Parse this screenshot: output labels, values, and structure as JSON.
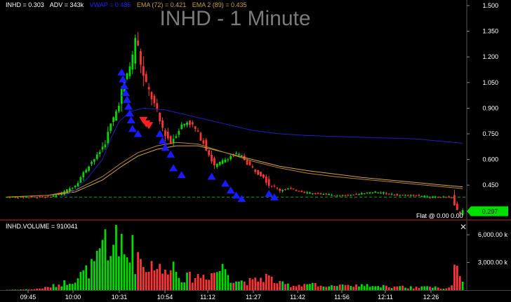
{
  "chart_data": [
    {
      "type": "candlestick",
      "title": "INHD - 1 Minute",
      "header": {
        "symbol_price": "INHD = 0.303",
        "adv": "ADV = 343k",
        "vwap": "VWAP = 0.485",
        "ema72": "EMA (72) = 0.421",
        "ema89": "EMA 2 (89) = 0.435"
      },
      "y_ticks": [
        "1.500",
        "1.350",
        "1.200",
        "1.050",
        "0.900",
        "0.750",
        "0.600",
        "0.450"
      ],
      "ylim": [
        0.25,
        1.5
      ],
      "last_price_label": "0.297",
      "last_price": 0.297,
      "reference_line": 0.38,
      "flat_label": "Flat @ 0.00  0.00",
      "x_ticks": [
        "09:45",
        "10:00",
        "10:31",
        "10:54",
        "11:12",
        "11:27",
        "11:42",
        "11:56",
        "12:11",
        "12:26"
      ],
      "price_path": [
        [
          0,
          0.38
        ],
        [
          10,
          0.38
        ],
        [
          15,
          0.38
        ],
        [
          20,
          0.4
        ],
        [
          25,
          0.45
        ],
        [
          28,
          0.52
        ],
        [
          30,
          0.57
        ],
        [
          33,
          0.62
        ],
        [
          36,
          0.7
        ],
        [
          38,
          0.8
        ],
        [
          40,
          0.88
        ],
        [
          42,
          1.0
        ],
        [
          44,
          1.1
        ],
        [
          46,
          1.2
        ],
        [
          47,
          1.32
        ],
        [
          48,
          1.25
        ],
        [
          50,
          1.08
        ],
        [
          52,
          1.0
        ],
        [
          54,
          0.92
        ],
        [
          56,
          0.82
        ],
        [
          58,
          0.75
        ],
        [
          60,
          0.7
        ],
        [
          62,
          0.75
        ],
        [
          64,
          0.8
        ],
        [
          66,
          0.82
        ],
        [
          68,
          0.8
        ],
        [
          70,
          0.75
        ],
        [
          72,
          0.7
        ],
        [
          74,
          0.63
        ],
        [
          76,
          0.56
        ],
        [
          78,
          0.58
        ],
        [
          80,
          0.6
        ],
        [
          82,
          0.62
        ],
        [
          84,
          0.63
        ],
        [
          86,
          0.62
        ],
        [
          88,
          0.58
        ],
        [
          90,
          0.55
        ],
        [
          92,
          0.52
        ],
        [
          94,
          0.5
        ],
        [
          96,
          0.45
        ],
        [
          98,
          0.44
        ],
        [
          100,
          0.42
        ],
        [
          103,
          0.43
        ],
        [
          106,
          0.42
        ],
        [
          109,
          0.41
        ],
        [
          112,
          0.4
        ],
        [
          116,
          0.4
        ],
        [
          120,
          0.39
        ],
        [
          125,
          0.39
        ],
        [
          130,
          0.4
        ],
        [
          135,
          0.41
        ],
        [
          140,
          0.4
        ],
        [
          145,
          0.39
        ],
        [
          150,
          0.39
        ],
        [
          155,
          0.38
        ],
        [
          160,
          0.38
        ],
        [
          163,
          0.38
        ],
        [
          164,
          0.33
        ],
        [
          165,
          0.29
        ],
        [
          166,
          0.28
        ],
        [
          167,
          0.297
        ]
      ],
      "vwap_path": [
        [
          20,
          0.38
        ],
        [
          25,
          0.42
        ],
        [
          30,
          0.5
        ],
        [
          35,
          0.6
        ],
        [
          38,
          0.72
        ],
        [
          41,
          0.82
        ],
        [
          45,
          0.88
        ],
        [
          50,
          0.9
        ],
        [
          58,
          0.89
        ],
        [
          66,
          0.86
        ],
        [
          74,
          0.83
        ],
        [
          82,
          0.8
        ],
        [
          90,
          0.77
        ],
        [
          100,
          0.75
        ],
        [
          110,
          0.74
        ],
        [
          120,
          0.735
        ],
        [
          130,
          0.73
        ],
        [
          140,
          0.725
        ],
        [
          150,
          0.72
        ],
        [
          160,
          0.705
        ],
        [
          167,
          0.695
        ]
      ],
      "ema72_path": [
        [
          0,
          0.38
        ],
        [
          15,
          0.39
        ],
        [
          25,
          0.42
        ],
        [
          35,
          0.5
        ],
        [
          42,
          0.58
        ],
        [
          48,
          0.64
        ],
        [
          55,
          0.68
        ],
        [
          62,
          0.7
        ],
        [
          70,
          0.69
        ],
        [
          80,
          0.64
        ],
        [
          90,
          0.59
        ],
        [
          100,
          0.55
        ],
        [
          110,
          0.52
        ],
        [
          120,
          0.5
        ],
        [
          130,
          0.485
        ],
        [
          140,
          0.47
        ],
        [
          150,
          0.455
        ],
        [
          160,
          0.44
        ],
        [
          167,
          0.43
        ]
      ],
      "ema89_path": [
        [
          0,
          0.38
        ],
        [
          15,
          0.39
        ],
        [
          25,
          0.41
        ],
        [
          35,
          0.48
        ],
        [
          42,
          0.56
        ],
        [
          48,
          0.62
        ],
        [
          55,
          0.66
        ],
        [
          62,
          0.68
        ],
        [
          70,
          0.68
        ],
        [
          80,
          0.64
        ],
        [
          90,
          0.6
        ],
        [
          100,
          0.56
        ],
        [
          110,
          0.535
        ],
        [
          120,
          0.515
        ],
        [
          130,
          0.495
        ],
        [
          140,
          0.48
        ],
        [
          150,
          0.465
        ],
        [
          160,
          0.45
        ],
        [
          167,
          0.44
        ]
      ],
      "buy_arrows": [
        [
          42,
          1.12
        ],
        [
          42.5,
          1.08
        ],
        [
          43,
          1.04
        ],
        [
          43.5,
          1.0
        ],
        [
          44,
          0.96
        ],
        [
          44.5,
          0.92
        ],
        [
          45,
          0.88
        ],
        [
          45.5,
          0.84
        ],
        [
          46,
          0.79
        ],
        [
          48,
          0.76
        ],
        [
          56,
          0.76
        ],
        [
          57,
          0.72
        ],
        [
          58,
          0.68
        ],
        [
          60,
          0.64
        ],
        [
          61,
          0.56
        ],
        [
          64,
          0.52
        ],
        [
          75,
          0.51
        ],
        [
          80,
          0.47
        ],
        [
          82,
          0.43
        ],
        [
          84,
          0.4
        ],
        [
          86,
          0.38
        ],
        [
          96,
          0.41
        ],
        [
          98,
          0.39
        ]
      ],
      "sell_arrows": [
        [
          50,
          0.82
        ],
        [
          51,
          0.8
        ],
        [
          52,
          0.79
        ]
      ]
    },
    {
      "type": "bar",
      "title": "INHD.VOLUME = 910041",
      "y_ticks": [
        "6,000.00 k",
        "3,000.00 k"
      ],
      "ylim": [
        0,
        7300
      ],
      "volume_path": [
        [
          0,
          30
        ],
        [
          10,
          100
        ],
        [
          15,
          300
        ],
        [
          20,
          700
        ],
        [
          25,
          1200
        ],
        [
          28,
          1800
        ],
        [
          30,
          2200
        ],
        [
          33,
          3000
        ],
        [
          35,
          4200
        ],
        [
          36,
          5800
        ],
        [
          37,
          3400
        ],
        [
          38,
          3800
        ],
        [
          39,
          7000
        ],
        [
          40,
          5000
        ],
        [
          41,
          3200
        ],
        [
          42,
          5600
        ],
        [
          43,
          4200
        ],
        [
          44,
          3600
        ],
        [
          45,
          5200
        ],
        [
          46,
          4400
        ],
        [
          47,
          3000
        ],
        [
          48,
          4000
        ],
        [
          50,
          2800
        ],
        [
          52,
          2500
        ],
        [
          54,
          3200
        ],
        [
          56,
          2200
        ],
        [
          58,
          1800
        ],
        [
          60,
          3600
        ],
        [
          62,
          2000
        ],
        [
          65,
          1300
        ],
        [
          70,
          1500
        ],
        [
          75,
          1800
        ],
        [
          80,
          2500
        ],
        [
          82,
          1400
        ],
        [
          85,
          1000
        ],
        [
          90,
          900
        ],
        [
          95,
          1500
        ],
        [
          100,
          700
        ],
        [
          105,
          500
        ],
        [
          110,
          700
        ],
        [
          115,
          600
        ],
        [
          120,
          500
        ],
        [
          125,
          400
        ],
        [
          130,
          500
        ],
        [
          135,
          400
        ],
        [
          140,
          400
        ],
        [
          145,
          350
        ],
        [
          150,
          300
        ],
        [
          155,
          300
        ],
        [
          160,
          250
        ],
        [
          163,
          400
        ],
        [
          164,
          2800
        ],
        [
          165,
          2000
        ],
        [
          166,
          1500
        ],
        [
          167,
          1200
        ]
      ]
    }
  ],
  "colors": {
    "up": "#00dc00",
    "down": "#ff3333",
    "vwap": "#1b1bc8",
    "ema72": "#b8860b",
    "ema89": "#d4a040",
    "reference": "#00aa00",
    "buy_arrow": "#1a1aff",
    "sell_arrow": "#ff2020",
    "last_price_bg": "#00e000",
    "axis_text": "#ffffff",
    "divider": "#7a1c1c",
    "header_symbol": "#ffffff",
    "header_adv": "#ffffff",
    "header_vwap": "#2020ff",
    "header_ema72": "#c8a020",
    "header_ema89": "#c8a020"
  }
}
